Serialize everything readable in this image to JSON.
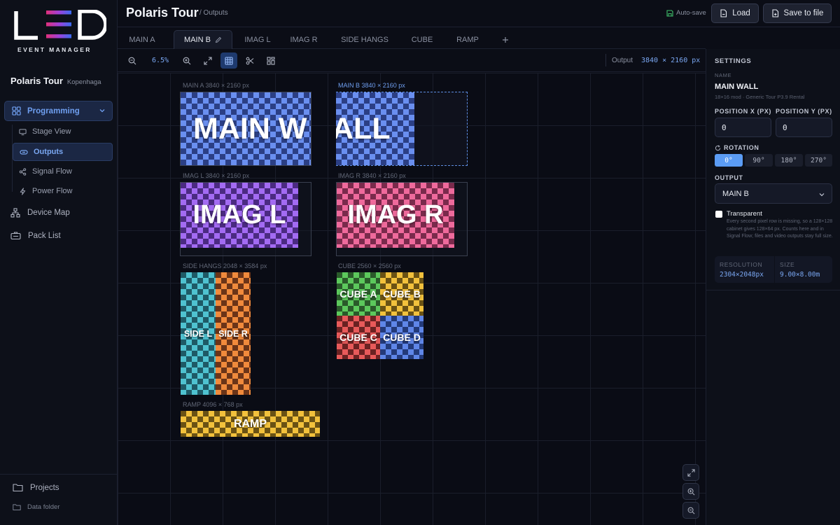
{
  "app": {
    "logo_letters": "LED",
    "logo_subtitle": "EVENT MANAGER",
    "colors": {
      "accent": "#6f9ff0",
      "background": "#0b0d16",
      "selected_rotation": "#5b9cf4"
    }
  },
  "sidebar": {
    "project_name": "Polaris Tour",
    "project_location": "Kopenhaga",
    "programming_label": "Programming",
    "sub_items": [
      {
        "label": "Stage View",
        "icon": "monitor-icon"
      },
      {
        "label": "Outputs",
        "icon": "outputs-icon",
        "active": true
      },
      {
        "label": "Signal Flow",
        "icon": "share-icon"
      },
      {
        "label": "Power Flow",
        "icon": "lightning-icon"
      }
    ],
    "items": [
      {
        "label": "Device Map",
        "icon": "network-icon"
      },
      {
        "label": "Pack List",
        "icon": "pack-icon"
      }
    ],
    "projects_label": "Projects",
    "data_folder_label": "Data folder"
  },
  "header": {
    "title": "Polaris Tour",
    "breadcrumb": "/ Outputs",
    "autosave_label": "Auto-save",
    "load_label": "Load",
    "save_label": "Save to file"
  },
  "tabs": [
    {
      "label": "MAIN A"
    },
    {
      "label": "MAIN B",
      "active": true
    },
    {
      "label": "IMAG L"
    },
    {
      "label": "IMAG R"
    },
    {
      "label": "SIDE HANGS"
    },
    {
      "label": "CUBE"
    },
    {
      "label": "RAMP"
    }
  ],
  "toolbar": {
    "zoom_value": "6.5%",
    "output_label": "Output",
    "output_value": "3840 × 2160 px"
  },
  "canvas": {
    "slots": [
      {
        "label": "MAIN A  3840 × 2160 px"
      },
      {
        "label": "MAIN B  3840 × 2160 px",
        "selected": true
      },
      {
        "label": "IMAG L  3840 × 2160 px"
      },
      {
        "label": "IMAG R  3840 × 2160 px"
      },
      {
        "label": "SIDE HANGS  2048 × 3584 px"
      },
      {
        "label": "CUBE  2560 × 2560 px"
      },
      {
        "label": "RAMP  4096 × 768 px"
      }
    ],
    "screens": {
      "main_wall_left": "MAIN W",
      "main_wall_right": "ALL",
      "imag_l": "IMAG L",
      "imag_r": "IMAG R",
      "side_l": "SIDE L",
      "side_r": "SIDE R",
      "cube_a": "CUBE A",
      "cube_b": "CUBE B",
      "cube_c": "CUBE C",
      "cube_d": "CUBE D",
      "ramp": "RAMP"
    }
  },
  "settings": {
    "heading": "SETTINGS",
    "name_caption": "NAME",
    "name": "MAIN WALL",
    "name_meta": "18×16 mod · Generic Tour P3.9 Rental",
    "pos_x_label": "POSITION X (PX)",
    "pos_y_label": "POSITION Y (PX)",
    "pos_x": "0",
    "pos_y": "0",
    "rotation_label": "ROTATION",
    "rotations": [
      "0°",
      "90°",
      "180°",
      "270°"
    ],
    "rotation_selected": "0°",
    "output_label": "OUTPUT",
    "output_value": "MAIN B",
    "transparent_label": "Transparent",
    "transparent_note": "Every second pixel row is missing, so a 128×128 cabinet gives 128×64 px. Counts here and in Signal Flow; files and video outputs stay full size.",
    "resolution_label": "RESOLUTION",
    "resolution_value": "2304×2048px",
    "size_label": "SIZE",
    "size_value": "9.00×8.00m"
  }
}
